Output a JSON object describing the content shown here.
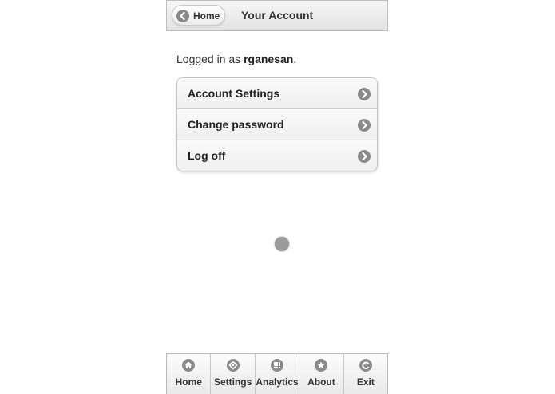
{
  "header": {
    "back_label": "Home",
    "title": "Your Account"
  },
  "login": {
    "prefix": "Logged in as ",
    "username": "rganesan",
    "suffix": "."
  },
  "menu": {
    "items": [
      {
        "label": "Account Settings",
        "icon": "chevron-right-icon"
      },
      {
        "label": "Change password",
        "icon": "chevron-right-icon"
      },
      {
        "label": "Log off",
        "icon": "chevron-right-icon"
      }
    ]
  },
  "tabbar": {
    "items": [
      {
        "label": "Home",
        "icon": "home-icon"
      },
      {
        "label": "Settings",
        "icon": "gear-icon"
      },
      {
        "label": "Analytics",
        "icon": "grid-icon"
      },
      {
        "label": "About",
        "icon": "star-icon"
      },
      {
        "label": "Exit",
        "icon": "back-arrow-icon"
      }
    ]
  }
}
